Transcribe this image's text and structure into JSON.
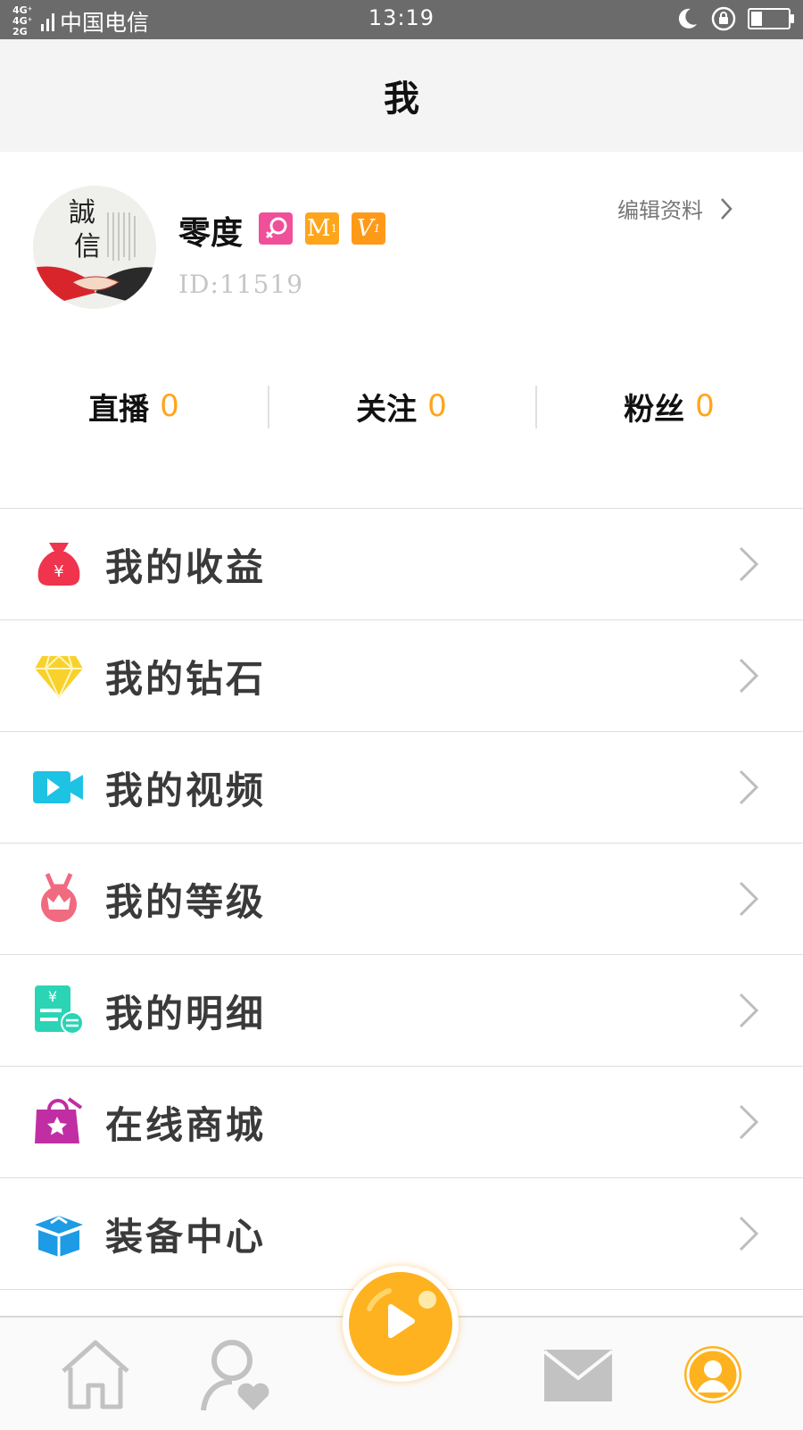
{
  "status_bar": {
    "network_1": "4G⁺",
    "network_2": "4G⁺ 2G",
    "carrier": "中国电信",
    "time": "13:19",
    "icons": [
      "moon-icon",
      "rotation-lock-icon",
      "battery-icon"
    ],
    "battery_level": 0.3
  },
  "header": {
    "title": "我"
  },
  "profile": {
    "avatar_text": "誠信",
    "name": "零度",
    "badges": [
      {
        "icon": "female-icon",
        "text": "♀",
        "color": "#f04f9a"
      },
      {
        "icon": "m-level-badge",
        "text": "M",
        "sub": "1",
        "color": "#ffa51c"
      },
      {
        "icon": "v-level-badge",
        "text": "V",
        "sub": "1",
        "color": "#ff9a18"
      }
    ],
    "id_text": "ID:11519",
    "edit_label": "编辑资料"
  },
  "stats": [
    {
      "label": "直播",
      "value": "0"
    },
    {
      "label": "关注",
      "value": "0"
    },
    {
      "label": "粉丝",
      "value": "0"
    }
  ],
  "menu": [
    {
      "label": "我的收益",
      "icon": "money-bag-icon",
      "color": "#f0344d"
    },
    {
      "label": "我的钻石",
      "icon": "diamond-icon",
      "color": "#f8d12c"
    },
    {
      "label": "我的视频",
      "icon": "video-camera-icon",
      "color": "#1ec3e4"
    },
    {
      "label": "我的等级",
      "icon": "crown-medal-icon",
      "color": "#f06a80"
    },
    {
      "label": "我的明细",
      "icon": "bill-detail-icon",
      "color": "#2ad4b5"
    },
    {
      "label": "在线商城",
      "icon": "shopping-bag-icon",
      "color": "#c12ea3"
    },
    {
      "label": "装备中心",
      "icon": "equipment-box-icon",
      "color": "#1d9be5"
    }
  ],
  "tabbar": {
    "items": [
      "home-icon",
      "follow-icon",
      "live-play-icon",
      "message-icon",
      "profile-icon"
    ],
    "active": "profile-icon",
    "accent": "#ffb21f"
  }
}
